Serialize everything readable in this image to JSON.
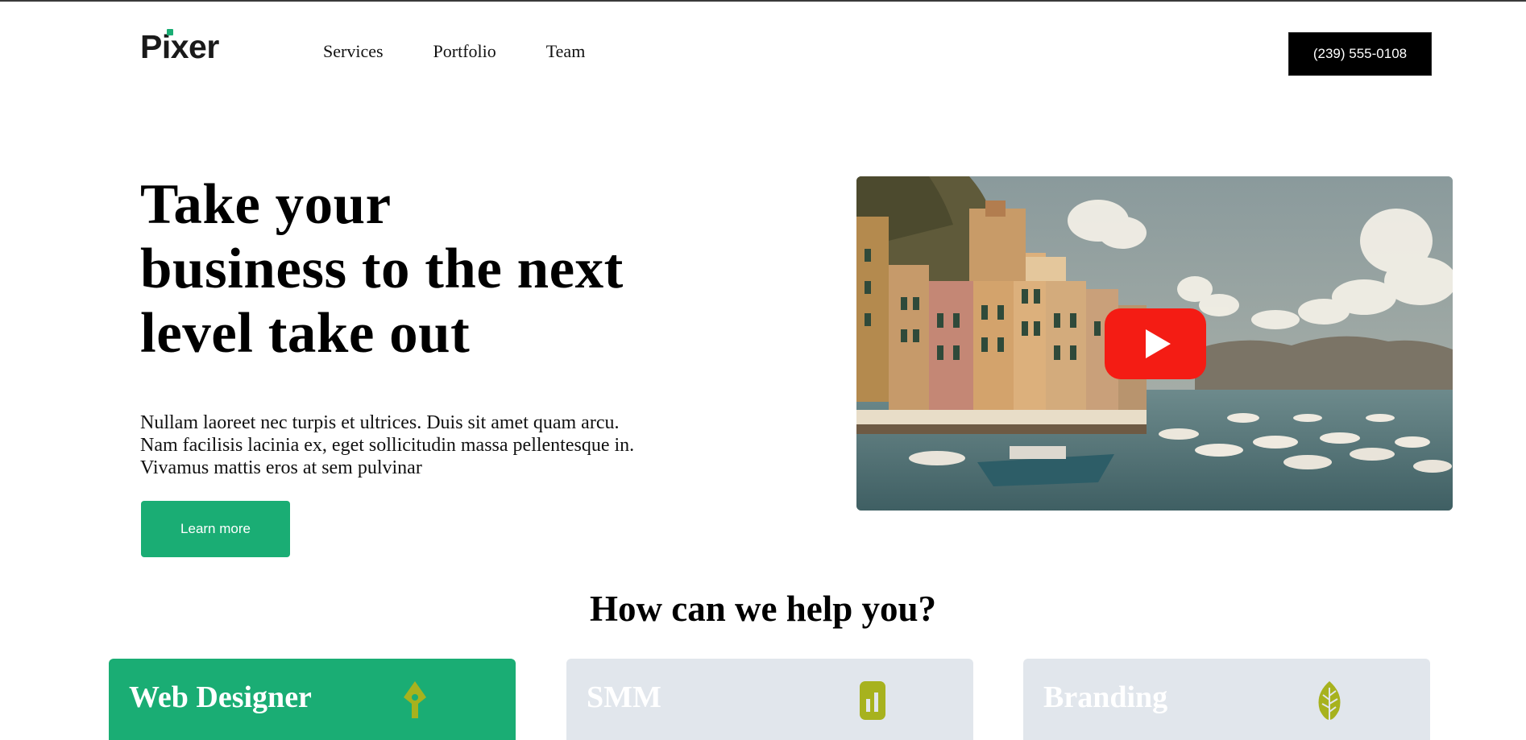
{
  "header": {
    "logo": "Pixer",
    "nav": [
      "Services",
      "Portfolio",
      "Team"
    ],
    "phone": "(239) 555-0108"
  },
  "hero": {
    "title_lines": [
      "Take your",
      "business to the next",
      "level take out"
    ],
    "copy_lines": [
      "Nullam laoreet nec turpis et ultrices. Duis sit amet quam arcu.",
      "Nam facilisis lacinia ex, eget sollicitudin massa pellentesque in.",
      "Vivamus mattis eros at sem pulvinar"
    ],
    "cta": "Learn more",
    "video": {
      "play_icon": "youtube-play-icon",
      "play_color": "#f41c14"
    }
  },
  "services": {
    "title": "How can we help you?",
    "cards": [
      {
        "title": "Web Designer",
        "icon": "pen-tool-icon",
        "bg": "#1aad74"
      },
      {
        "title": "SMM",
        "icon": "phone-chart-icon",
        "bg": "#e1e6ec"
      },
      {
        "title": "Branding",
        "icon": "leaf-icon",
        "bg": "#e1e6ec"
      }
    ]
  },
  "colors": {
    "accent": "#1aad74",
    "icon": "#a7b21e",
    "dark": "#000000"
  }
}
